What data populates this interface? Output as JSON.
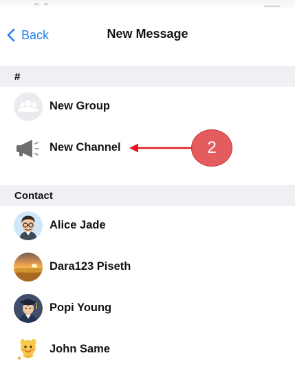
{
  "navbar": {
    "back_label": "Back",
    "title": "New Message"
  },
  "sections": {
    "hash_header": "#",
    "contact_header": "Contact"
  },
  "actions": [
    {
      "label": "New Group",
      "icon": "group-icon"
    },
    {
      "label": "New Channel",
      "icon": "megaphone-icon"
    }
  ],
  "contacts": [
    {
      "name": "Alice Jade",
      "avatar": "cartoon-man-glasses-avatar"
    },
    {
      "name": "Dara123 Piseth",
      "avatar": "sunset-landscape-avatar"
    },
    {
      "name": "Popi Young",
      "avatar": "graduate-avatar"
    },
    {
      "name": "John Same",
      "avatar": "yellow-creature-avatar"
    }
  ],
  "annotation": {
    "step_number": "2",
    "color": "#e35d5e"
  },
  "colors": {
    "accent": "#1f7ff0",
    "section_bg": "#f0f0f4",
    "annotation_arrow": "#e0191e"
  }
}
